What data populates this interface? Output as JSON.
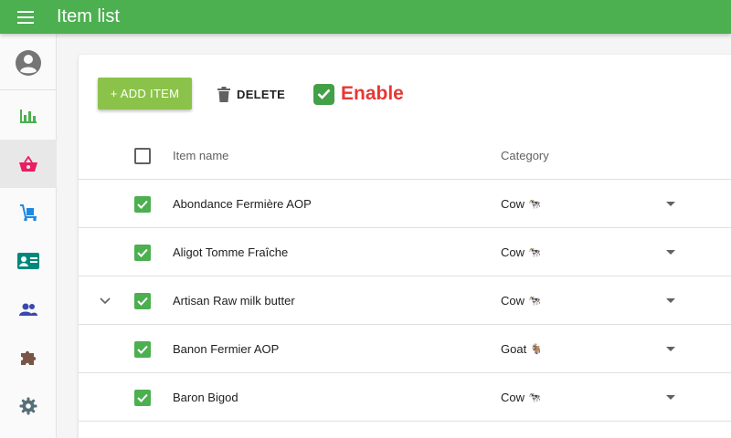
{
  "app": {
    "title": "Item list"
  },
  "sidebar": {
    "items": [
      {
        "name": "account-icon",
        "active": false
      },
      {
        "name": "chart-icon",
        "active": false
      },
      {
        "name": "basket-icon",
        "active": true
      },
      {
        "name": "dolly-icon",
        "active": false
      },
      {
        "name": "contact-card-icon",
        "active": false
      },
      {
        "name": "people-icon",
        "active": false
      },
      {
        "name": "puzzle-icon",
        "active": false
      },
      {
        "name": "settings-icon",
        "active": false
      }
    ]
  },
  "toolbar": {
    "add_label": "+ ADD ITEM",
    "delete_label": "DELETE",
    "enable_label": "Enable"
  },
  "table": {
    "columns": [
      "Item name",
      "Category"
    ],
    "rows": [
      {
        "name": "Abondance Fermière AOP",
        "category": "Cow",
        "checked": true,
        "expandable": false
      },
      {
        "name": "Aligot Tomme Fraîche",
        "category": "Cow",
        "checked": true,
        "expandable": false
      },
      {
        "name": "Artisan Raw milk butter",
        "category": "Cow",
        "checked": true,
        "expandable": true
      },
      {
        "name": "Banon Fermier AOP",
        "category": "Goat",
        "checked": true,
        "expandable": false
      },
      {
        "name": "Baron Bigod",
        "category": "Cow",
        "checked": true,
        "expandable": false
      }
    ]
  },
  "colors": {
    "appbar": "#4caf50",
    "add_button": "#8bc34a",
    "enable_text": "#e53935",
    "checkbox": "#4caf50"
  }
}
